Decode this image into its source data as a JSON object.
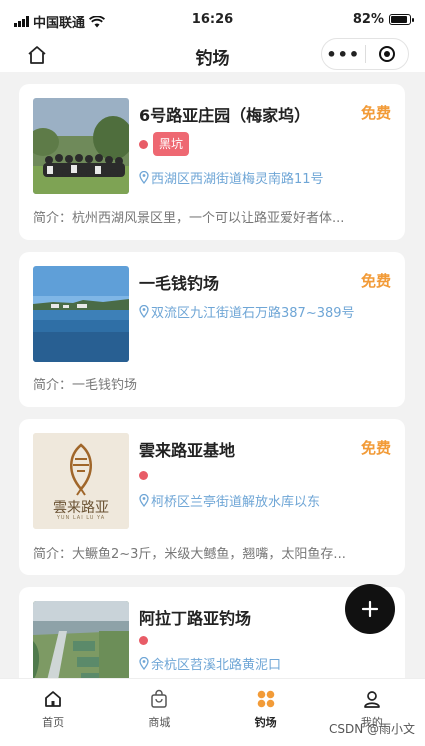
{
  "status": {
    "carrier": "中国联通",
    "time": "16:26",
    "battery": "82%"
  },
  "nav": {
    "title": "钓场",
    "more_icon": "more-dots-icon",
    "target_icon": "target-icon"
  },
  "cards": [
    {
      "name": "6号路亚庄园（梅家坞）",
      "price": "免费",
      "tag": "黑坑",
      "address": "西湖区西湖街道梅灵南路11号",
      "intro": "简介：杭州西湖风景区里，一个可以让路亚爱好者体..."
    },
    {
      "name": "一毛钱钓场",
      "price": "免费",
      "address": "双流区九江街道石万路387~389号",
      "intro": "简介：一毛钱钓场"
    },
    {
      "name": "雲来路亚基地",
      "price": "免费",
      "address": "柯桥区兰亭街道解放水库以东",
      "intro": "简介：大鳜鱼2~3斤，米级大鳡鱼，翘嘴，太阳鱼存...",
      "logo_text": "雲来路亚",
      "logo_sub": "YUN LAI LU YA"
    },
    {
      "name": "阿拉丁路亚钓场",
      "address": "余杭区苕溪北路黄泥口"
    }
  ],
  "tabs": [
    {
      "label": "首页",
      "icon": "home-icon"
    },
    {
      "label": "商城",
      "icon": "shop-bag-icon"
    },
    {
      "label": "钓场",
      "icon": "grid-dots-icon",
      "active": true
    },
    {
      "label": "我的",
      "icon": "user-icon"
    }
  ],
  "watermark": "CSDN @雨小文",
  "colors": {
    "accent": "#f29b38",
    "tag": "#ee6872",
    "address": "#6fa6d6",
    "active_tab": "#f29b38"
  }
}
